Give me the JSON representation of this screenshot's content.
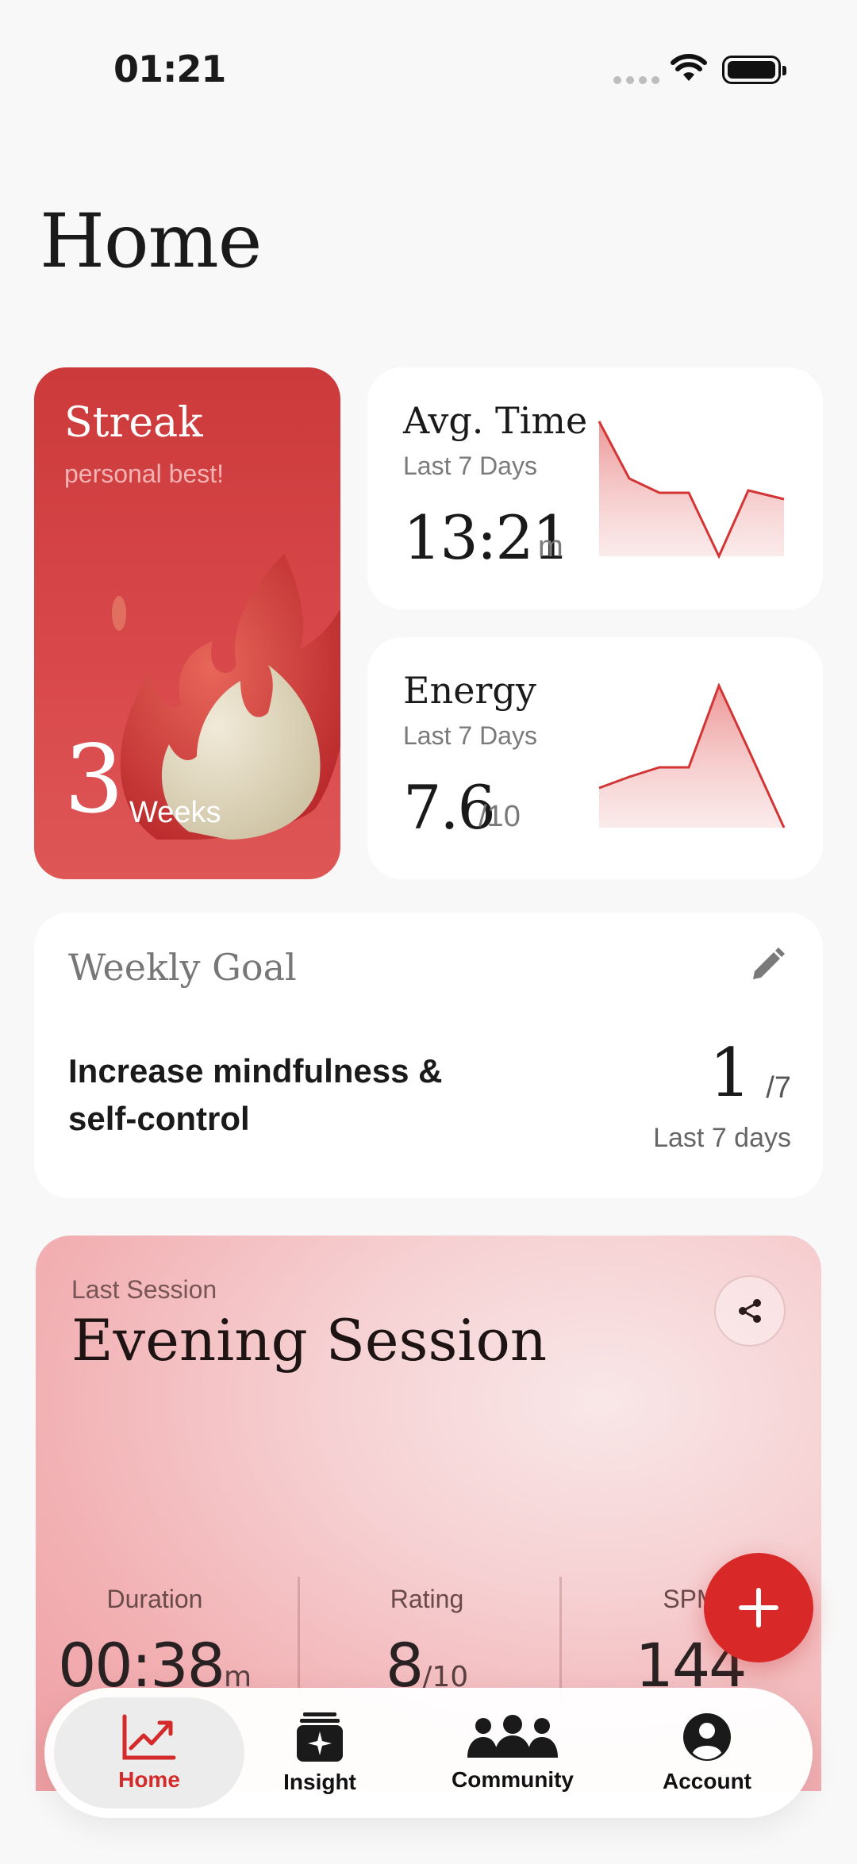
{
  "status_bar": {
    "time": "01:21"
  },
  "page": {
    "title": "Home"
  },
  "streak": {
    "title": "Streak",
    "subtitle": "personal best!",
    "value": "3",
    "unit": "Weeks"
  },
  "avg_time": {
    "title": "Avg. Time",
    "period": "Last 7 Days",
    "value": "13:21",
    "unit": "m"
  },
  "energy": {
    "title": "Energy",
    "period": "Last 7 Days",
    "value": "7.6",
    "unit": "/10"
  },
  "weekly_goal": {
    "title": "Weekly Goal",
    "text": "Increase mindfulness & self-control",
    "value": "1",
    "total": "/7",
    "period": "Last 7 days"
  },
  "last_session": {
    "label": "Last Session",
    "title": "Evening Session",
    "stats": [
      {
        "label": "Duration",
        "value": "00:38",
        "unit": "m"
      },
      {
        "label": "Rating",
        "value": "8",
        "unit": "/10"
      },
      {
        "label": "SPM",
        "value": "144",
        "unit": ""
      }
    ]
  },
  "tabs": [
    {
      "label": "Home",
      "active": true
    },
    {
      "label": "Insight",
      "active": false
    },
    {
      "label": "Community",
      "active": false
    },
    {
      "label": "Account",
      "active": false
    }
  ],
  "colors": {
    "accent": "#d92828",
    "streak_card": "#cc3a3b"
  }
}
